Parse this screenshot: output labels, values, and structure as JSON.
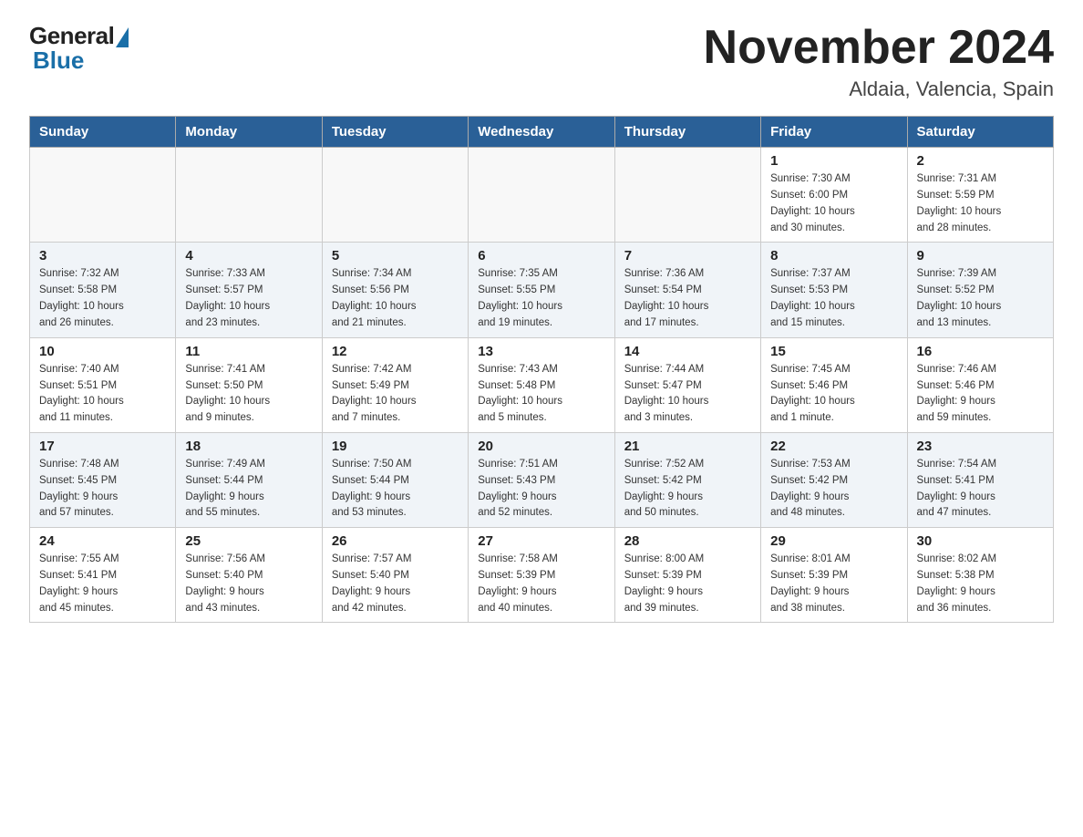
{
  "header": {
    "logo_general": "General",
    "logo_blue": "Blue",
    "month_title": "November 2024",
    "location": "Aldaia, Valencia, Spain"
  },
  "weekdays": [
    "Sunday",
    "Monday",
    "Tuesday",
    "Wednesday",
    "Thursday",
    "Friday",
    "Saturday"
  ],
  "weeks": [
    [
      {
        "day": "",
        "info": ""
      },
      {
        "day": "",
        "info": ""
      },
      {
        "day": "",
        "info": ""
      },
      {
        "day": "",
        "info": ""
      },
      {
        "day": "",
        "info": ""
      },
      {
        "day": "1",
        "info": "Sunrise: 7:30 AM\nSunset: 6:00 PM\nDaylight: 10 hours\nand 30 minutes."
      },
      {
        "day": "2",
        "info": "Sunrise: 7:31 AM\nSunset: 5:59 PM\nDaylight: 10 hours\nand 28 minutes."
      }
    ],
    [
      {
        "day": "3",
        "info": "Sunrise: 7:32 AM\nSunset: 5:58 PM\nDaylight: 10 hours\nand 26 minutes."
      },
      {
        "day": "4",
        "info": "Sunrise: 7:33 AM\nSunset: 5:57 PM\nDaylight: 10 hours\nand 23 minutes."
      },
      {
        "day": "5",
        "info": "Sunrise: 7:34 AM\nSunset: 5:56 PM\nDaylight: 10 hours\nand 21 minutes."
      },
      {
        "day": "6",
        "info": "Sunrise: 7:35 AM\nSunset: 5:55 PM\nDaylight: 10 hours\nand 19 minutes."
      },
      {
        "day": "7",
        "info": "Sunrise: 7:36 AM\nSunset: 5:54 PM\nDaylight: 10 hours\nand 17 minutes."
      },
      {
        "day": "8",
        "info": "Sunrise: 7:37 AM\nSunset: 5:53 PM\nDaylight: 10 hours\nand 15 minutes."
      },
      {
        "day": "9",
        "info": "Sunrise: 7:39 AM\nSunset: 5:52 PM\nDaylight: 10 hours\nand 13 minutes."
      }
    ],
    [
      {
        "day": "10",
        "info": "Sunrise: 7:40 AM\nSunset: 5:51 PM\nDaylight: 10 hours\nand 11 minutes."
      },
      {
        "day": "11",
        "info": "Sunrise: 7:41 AM\nSunset: 5:50 PM\nDaylight: 10 hours\nand 9 minutes."
      },
      {
        "day": "12",
        "info": "Sunrise: 7:42 AM\nSunset: 5:49 PM\nDaylight: 10 hours\nand 7 minutes."
      },
      {
        "day": "13",
        "info": "Sunrise: 7:43 AM\nSunset: 5:48 PM\nDaylight: 10 hours\nand 5 minutes."
      },
      {
        "day": "14",
        "info": "Sunrise: 7:44 AM\nSunset: 5:47 PM\nDaylight: 10 hours\nand 3 minutes."
      },
      {
        "day": "15",
        "info": "Sunrise: 7:45 AM\nSunset: 5:46 PM\nDaylight: 10 hours\nand 1 minute."
      },
      {
        "day": "16",
        "info": "Sunrise: 7:46 AM\nSunset: 5:46 PM\nDaylight: 9 hours\nand 59 minutes."
      }
    ],
    [
      {
        "day": "17",
        "info": "Sunrise: 7:48 AM\nSunset: 5:45 PM\nDaylight: 9 hours\nand 57 minutes."
      },
      {
        "day": "18",
        "info": "Sunrise: 7:49 AM\nSunset: 5:44 PM\nDaylight: 9 hours\nand 55 minutes."
      },
      {
        "day": "19",
        "info": "Sunrise: 7:50 AM\nSunset: 5:44 PM\nDaylight: 9 hours\nand 53 minutes."
      },
      {
        "day": "20",
        "info": "Sunrise: 7:51 AM\nSunset: 5:43 PM\nDaylight: 9 hours\nand 52 minutes."
      },
      {
        "day": "21",
        "info": "Sunrise: 7:52 AM\nSunset: 5:42 PM\nDaylight: 9 hours\nand 50 minutes."
      },
      {
        "day": "22",
        "info": "Sunrise: 7:53 AM\nSunset: 5:42 PM\nDaylight: 9 hours\nand 48 minutes."
      },
      {
        "day": "23",
        "info": "Sunrise: 7:54 AM\nSunset: 5:41 PM\nDaylight: 9 hours\nand 47 minutes."
      }
    ],
    [
      {
        "day": "24",
        "info": "Sunrise: 7:55 AM\nSunset: 5:41 PM\nDaylight: 9 hours\nand 45 minutes."
      },
      {
        "day": "25",
        "info": "Sunrise: 7:56 AM\nSunset: 5:40 PM\nDaylight: 9 hours\nand 43 minutes."
      },
      {
        "day": "26",
        "info": "Sunrise: 7:57 AM\nSunset: 5:40 PM\nDaylight: 9 hours\nand 42 minutes."
      },
      {
        "day": "27",
        "info": "Sunrise: 7:58 AM\nSunset: 5:39 PM\nDaylight: 9 hours\nand 40 minutes."
      },
      {
        "day": "28",
        "info": "Sunrise: 8:00 AM\nSunset: 5:39 PM\nDaylight: 9 hours\nand 39 minutes."
      },
      {
        "day": "29",
        "info": "Sunrise: 8:01 AM\nSunset: 5:39 PM\nDaylight: 9 hours\nand 38 minutes."
      },
      {
        "day": "30",
        "info": "Sunrise: 8:02 AM\nSunset: 5:38 PM\nDaylight: 9 hours\nand 36 minutes."
      }
    ]
  ]
}
